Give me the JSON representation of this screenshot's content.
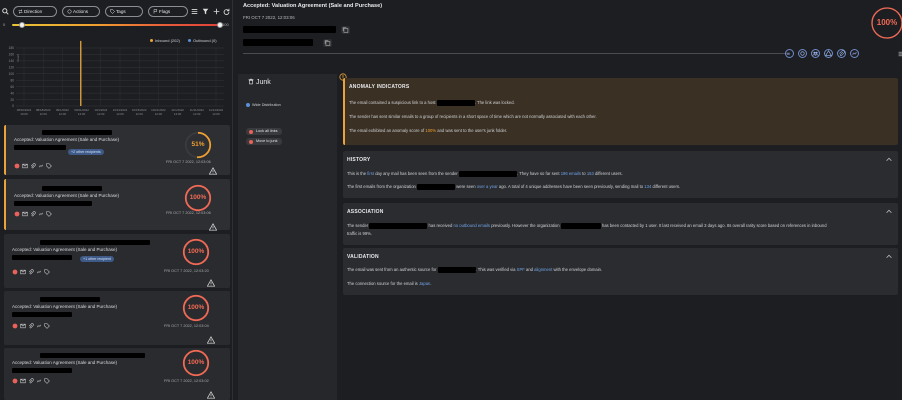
{
  "filters": {
    "direction": "Direction",
    "actions": "Actions",
    "tags": "Tags",
    "flags": "Flags"
  },
  "slider": {
    "min_label": "0",
    "max_label": "100",
    "low": 0.05,
    "high": 1.0
  },
  "chart_data": {
    "type": "bar",
    "title": "",
    "ylabel": "Count",
    "legend_placement": "top-right",
    "series": [
      {
        "name": "Inbound (202)",
        "color": "#e8a33a",
        "x": [
          "07:00am"
        ],
        "values": [
          202
        ]
      },
      {
        "name": "Outbound (0)",
        "color": "#5b8fd6",
        "x": [],
        "values": []
      }
    ],
    "yticks": [
      "180",
      "160",
      "140",
      "120",
      "100",
      "80",
      "60",
      "40",
      "20",
      "0"
    ],
    "xticks": [
      "08/16/2022 10:00",
      "08/18/2022 12:00",
      "09/1/2022 12:00",
      "09/21/2022 12:00",
      "10/1/2022 12:00",
      "10/13/2022 12:00",
      "10/15/2022 12:00",
      "10/21/2022 12:00",
      "11/1/2022 12:00",
      "11/11/2022 12:00",
      "11/14/2022 12:00"
    ],
    "ylim": [
      0,
      180
    ],
    "grid": true
  },
  "cards": [
    {
      "title": "Accepted: Valuation Agreement (Sale and Purchase)",
      "date": "FRI OCT 7 2022, 12:03:06",
      "score": "51%",
      "score_value": 51,
      "ring_color": "#f0a030",
      "pill": "+2 other recipients",
      "active": true
    },
    {
      "title": "Accepted: Valuation Agreement (Sale and Purchase)",
      "date": "FRI OCT 7 2022, 12:03:06",
      "score": "100%",
      "score_value": 100,
      "ring_color": "#f26a55",
      "pill": "",
      "active": true
    },
    {
      "title": "Accepted: Valuation Agreement (Sale and Purchase)",
      "date": "FRI OCT 7 2022, 12:03:20",
      "score": "100%",
      "score_value": 100,
      "ring_color": "#f26a55",
      "pill": "+1 other recipient",
      "active": false
    },
    {
      "title": "Accepted: Valuation Agreement (Sale and Purchase)",
      "date": "FRI OCT 7 2022, 12:03:04",
      "score": "100%",
      "score_value": 100,
      "ring_color": "#f26a55",
      "pill": "",
      "active": false
    },
    {
      "title": "Accepted: Valuation Agreement (Sale and Purchase)",
      "date": "FRI OCT 7 2022, 12:03:02",
      "score": "100%",
      "score_value": 100,
      "ring_color": "#f26a55",
      "pill": "",
      "active": false
    }
  ],
  "header": {
    "title": "Accepted: Valuation Agreement (Sale and Purchase)",
    "date": "FRI OCT 7 2022, 12:03:06",
    "score": "100%",
    "score_value": 100
  },
  "side": {
    "folder": "Junk",
    "wide_distribution": "Wide Distribution",
    "lock_links": "Lock all links",
    "move_junk": "Move to junk"
  },
  "anomaly": {
    "heading": "ANOMALY INDICATORS",
    "l1a": "The email contained a suspicious link to a host",
    "l1b": ". The link was locked.",
    "l2": "The sender has sent similar emails to a group of recipients in a short space of time which are not normally associated with each other.",
    "l3a": "The email exhibited an anomaly score of",
    "l3b": "100%",
    "l3c": "and was sent to the user's junk folder."
  },
  "history": {
    "heading": "HISTORY",
    "l1a": "This is the",
    "l1b": "first",
    "l1c": "day any mail has been seen from the sender",
    "l1d": ". They have so far sent",
    "l1e": "196 emails",
    "l1f": "to",
    "l1g": "153",
    "l1h": "different users.",
    "l2a": "The first emails from the organization",
    "l2b": "were seen",
    "l2c": "over a year",
    "l2d": "ago. A total of 4 unique addresses have been seen previously, sending mail to",
    "l2e": "134",
    "l2f": "different users."
  },
  "association": {
    "heading": "ASSOCIATION",
    "l1a": "The sender",
    "l1b": "has received",
    "l1c": "no outbound emails",
    "l1d": "previously. However the organization",
    "l1e": "has been contacted by 1 user. It last received an email 3 days ago. Its overall rarity score based on references in inbound",
    "l2": "traffic is 99%."
  },
  "validation": {
    "heading": "VALIDATION",
    "l1a": "The email was sent from an authentic source for",
    "l1b": ". This was verified via",
    "l1c": "SPF",
    "l1d": "and",
    "l1e": "alignment",
    "l1f": "with the envelope domain.",
    "l2a": "The connection source for the email is",
    "l2b": "Japan",
    "l2c": "."
  }
}
